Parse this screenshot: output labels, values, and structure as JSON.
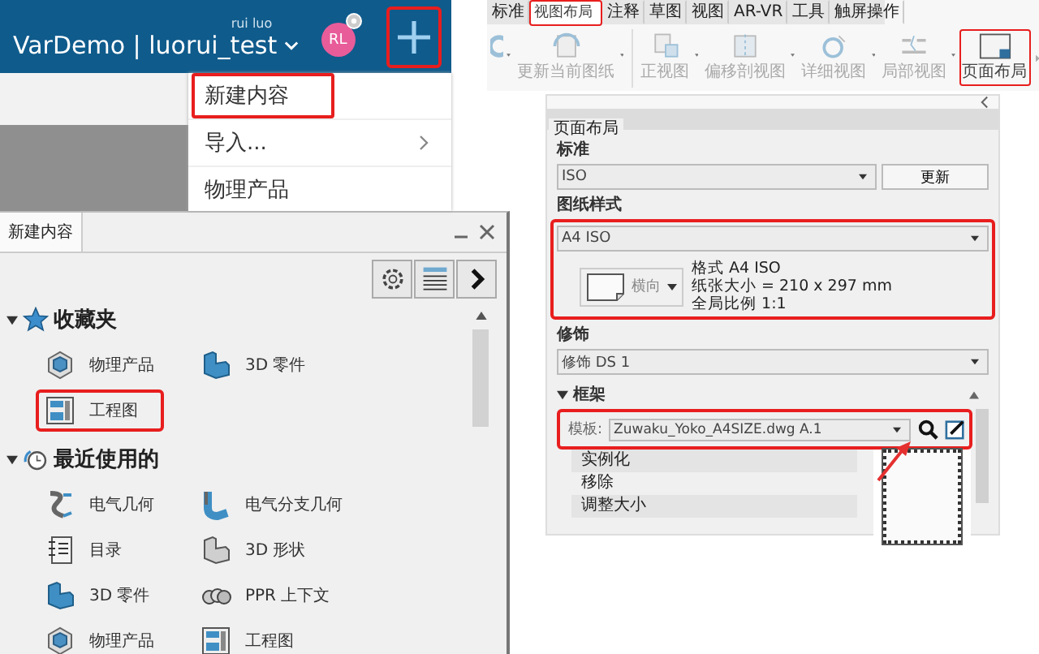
{
  "left": {
    "header": {
      "user": "rui luo",
      "title": "VarDemo | luorui_test",
      "avatar": "RL",
      "add_highlighted": true
    },
    "menu": [
      {
        "label": "新建内容",
        "highlighted": true,
        "submenu": false
      },
      {
        "label": "导入...",
        "highlighted": false,
        "submenu": true
      },
      {
        "label": "物理产品",
        "highlighted": false,
        "submenu": false
      }
    ],
    "panel": {
      "tab": "新建内容",
      "sections": [
        {
          "title": "收藏夹",
          "kind": "favorites",
          "expanded": true,
          "items": [
            {
              "label": "物理产品",
              "kind": "product",
              "highlighted": false
            },
            {
              "label": "3D 零件",
              "kind": "part",
              "highlighted": false
            },
            {
              "label": "工程图",
              "kind": "drawing",
              "highlighted": true
            }
          ]
        },
        {
          "title": "最近使用的",
          "kind": "recent",
          "expanded": true,
          "items": [
            {
              "label": "电气几何",
              "kind": "wire",
              "highlighted": false
            },
            {
              "label": "电气分支几何",
              "kind": "branch",
              "highlighted": false
            },
            {
              "label": "目录",
              "kind": "catalog",
              "highlighted": false
            },
            {
              "label": "3D 形状",
              "kind": "shape",
              "highlighted": false
            },
            {
              "label": "3D 零件",
              "kind": "part",
              "highlighted": false
            },
            {
              "label": "PPR 上下文",
              "kind": "ppr",
              "highlighted": false
            },
            {
              "label": "物理产品",
              "kind": "product",
              "highlighted": false
            },
            {
              "label": "工程图",
              "kind": "drawing",
              "highlighted": false
            }
          ]
        }
      ]
    }
  },
  "right": {
    "ribbon": {
      "tabs": [
        {
          "label": "标准",
          "selected": false,
          "highlighted": false
        },
        {
          "label": "视图布局",
          "selected": true,
          "highlighted": true
        },
        {
          "label": "注释",
          "selected": false,
          "highlighted": false
        },
        {
          "label": "草图",
          "selected": false,
          "highlighted": false
        },
        {
          "label": "视图",
          "selected": false,
          "highlighted": false
        },
        {
          "label": "AR-VR",
          "selected": false,
          "highlighted": false
        },
        {
          "label": "工具",
          "selected": false,
          "highlighted": false
        },
        {
          "label": "触屏操作",
          "selected": false,
          "highlighted": false
        }
      ],
      "tools": [
        {
          "kind": "partial",
          "dropdown": true,
          "highlighted": false
        },
        {
          "label": "更新当前图纸",
          "kind": "update",
          "dropdown": true,
          "highlighted": false
        },
        {
          "label": "正视图",
          "kind": "front",
          "dropdown": true,
          "highlighted": false
        },
        {
          "label": "偏移剖视图",
          "kind": "section",
          "dropdown": true,
          "highlighted": false
        },
        {
          "label": "详细视图",
          "kind": "detail",
          "dropdown": true,
          "highlighted": false
        },
        {
          "label": "局部视图",
          "kind": "local",
          "dropdown": true,
          "highlighted": false
        },
        {
          "label": "页面布局",
          "kind": "layout",
          "dropdown": false,
          "highlighted": true
        }
      ]
    },
    "panel": {
      "tab": "页面布局",
      "standard": {
        "label": "标准",
        "value": "ISO",
        "button": "更新"
      },
      "sheet_style": {
        "label": "图纸样式",
        "value": "A4 ISO",
        "highlighted": true,
        "orientation": "横向",
        "info": [
          "格式 A4 ISO",
          "纸张大小 = 210 x 297 mm",
          "全局比例 1:1"
        ]
      },
      "dressup": {
        "label": "修饰",
        "value": "修饰 DS 1"
      },
      "frame": {
        "label": "框架",
        "expanded": true,
        "template_label": "模板:",
        "template": "Zuwaku_Yoko_A4SIZE.dwg A.1",
        "highlighted": true,
        "actions": [
          "实例化",
          "移除",
          "调整大小"
        ]
      }
    }
  }
}
